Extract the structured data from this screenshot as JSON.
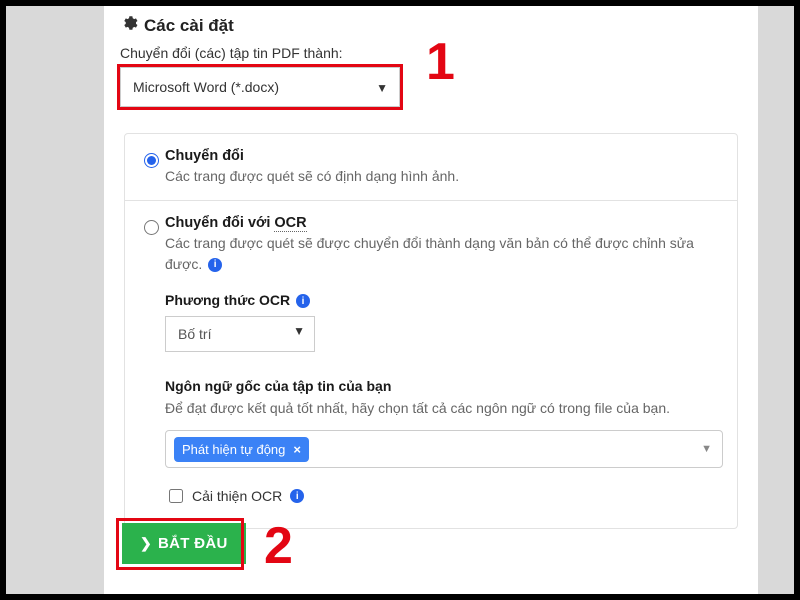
{
  "header": {
    "title": "Các cài đặt"
  },
  "convert": {
    "label": "Chuyển đổi (các) tập tin PDF thành:",
    "format_selected": "Microsoft Word (*.docx)"
  },
  "options": {
    "basic": {
      "title": "Chuyển đổi",
      "desc": "Các trang được quét sẽ có định dạng hình ảnh."
    },
    "ocr": {
      "title_pre": "Chuyển đổi với ",
      "title_dotted": "OCR",
      "desc": "Các trang được quét sẽ được chuyển đổi thành dạng văn bản có thể được chỉnh sửa được.",
      "method_label": "Phương thức OCR",
      "method_selected": "Bố trí",
      "lang_label": "Ngôn ngữ gốc của tập tin của bạn",
      "lang_hint": "Để đạt được kết quả tốt nhất, hãy chọn tất cả các ngôn ngữ có trong file của bạn.",
      "lang_tag": "Phát hiện tự động",
      "improve_label": "Cải thiện OCR"
    }
  },
  "start_label": "BẮT ĐẦU",
  "annotations": {
    "one": "1",
    "two": "2"
  }
}
